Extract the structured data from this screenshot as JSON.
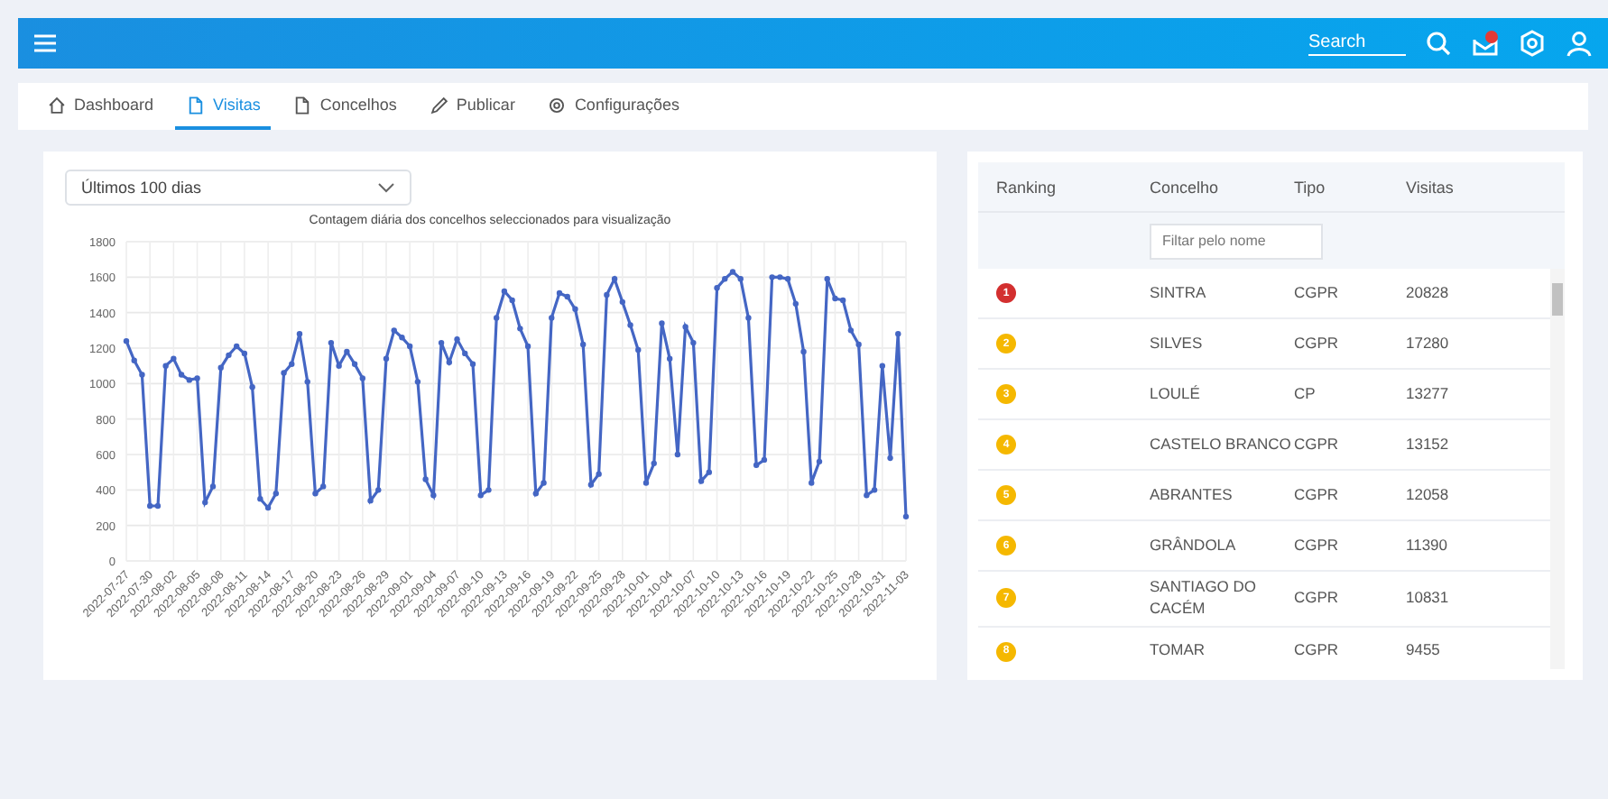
{
  "topbar": {
    "search_placeholder": "Search"
  },
  "tabs": [
    {
      "label": "Dashboard",
      "selected": false
    },
    {
      "label": "Visitas",
      "selected": true
    },
    {
      "label": "Concelhos",
      "selected": false
    },
    {
      "label": "Publicar",
      "selected": false
    },
    {
      "label": "Configurações",
      "selected": false
    }
  ],
  "period_select": {
    "value": "Últimos 100 dias"
  },
  "chart": {
    "chart_data": {
      "type": "line",
      "title": "Contagem diária dos concelhos seleccionados para visualização",
      "categories": [
        "2022-07-27",
        null,
        null,
        "2022-07-30",
        null,
        null,
        "2022-08-02",
        null,
        null,
        "2022-08-05",
        null,
        null,
        "2022-08-08",
        null,
        null,
        "2022-08-11",
        null,
        null,
        "2022-08-14",
        null,
        null,
        "2022-08-17",
        null,
        null,
        "2022-08-20",
        null,
        null,
        "2022-08-23",
        null,
        null,
        "2022-08-26",
        null,
        null,
        "2022-08-29",
        null,
        null,
        "2022-09-01",
        null,
        null,
        "2022-09-04",
        null,
        null,
        "2022-09-07",
        null,
        null,
        "2022-09-10",
        null,
        null,
        "2022-09-13",
        null,
        null,
        "2022-09-16",
        null,
        null,
        "2022-09-19",
        null,
        null,
        "2022-09-22",
        null,
        null,
        "2022-09-25",
        null,
        null,
        "2022-09-28",
        null,
        null,
        "2022-10-01",
        null,
        null,
        "2022-10-04",
        null,
        null,
        "2022-10-07",
        null,
        null,
        "2022-10-10",
        null,
        null,
        "2022-10-13",
        null,
        null,
        "2022-10-16",
        null,
        null,
        "2022-10-19",
        null,
        null,
        "2022-10-22",
        null,
        null,
        "2022-10-25",
        null,
        null,
        "2022-10-28",
        null,
        null,
        "2022-10-31",
        null,
        null,
        "2022-11-03"
      ],
      "grid": true,
      "series": [
        {
          "color": "#4466c4",
          "marker": true,
          "values": [
            1240,
            1130,
            1050,
            310,
            310,
            1100,
            1140,
            1050,
            1020,
            1030,
            330,
            420,
            1090,
            1160,
            1210,
            1170,
            980,
            350,
            300,
            380,
            1060,
            1110,
            1280,
            1010,
            380,
            420,
            1230,
            1100,
            1180,
            1110,
            1030,
            340,
            400,
            1140,
            1300,
            1260,
            1210,
            1010,
            460,
            370,
            1230,
            1120,
            1250,
            1170,
            1110,
            370,
            400,
            1370,
            1520,
            1470,
            1310,
            1210,
            380,
            440,
            1370,
            1510,
            1490,
            1420,
            1220,
            430,
            490,
            1500,
            1590,
            1460,
            1330,
            1190,
            440,
            550,
            1340,
            1140,
            600,
            1320,
            1230,
            450,
            500,
            1540,
            1590,
            1630,
            1590,
            1370,
            540,
            570,
            1600,
            1600,
            1590,
            1450,
            1180,
            440,
            560,
            1590,
            1480,
            1470,
            1300,
            1220,
            370,
            400,
            1100,
            580,
            1280,
            250
          ]
        }
      ],
      "ylim": [
        0,
        1800
      ],
      "yticks": [
        0,
        200,
        400,
        600,
        800,
        1000,
        1200,
        1400,
        1600,
        1800
      ]
    }
  },
  "ranking_table": {
    "columns": [
      "Ranking",
      "Concelho",
      "Tipo",
      "Visitas"
    ],
    "filter_placeholder": "Filtar pelo nome",
    "rows": [
      {
        "rank": "1",
        "color": "#d32f2f",
        "concelho": "SINTRA",
        "tipo": "CGPR",
        "visitas": "20828"
      },
      {
        "rank": "2",
        "color": "#f5b800",
        "concelho": "SILVES",
        "tipo": "CGPR",
        "visitas": "17280"
      },
      {
        "rank": "3",
        "color": "#f5b800",
        "concelho": "LOULÉ",
        "tipo": "CP",
        "visitas": "13277"
      },
      {
        "rank": "4",
        "color": "#f5b800",
        "concelho": "CASTELO BRANCO",
        "tipo": "CGPR",
        "visitas": "13152"
      },
      {
        "rank": "5",
        "color": "#f5b800",
        "concelho": "ABRANTES",
        "tipo": "CGPR",
        "visitas": "12058"
      },
      {
        "rank": "6",
        "color": "#f5b800",
        "concelho": "GRÂNDOLA",
        "tipo": "CGPR",
        "visitas": "11390"
      },
      {
        "rank": "7",
        "color": "#f5b800",
        "concelho": "SANTIAGO DO CACÉM",
        "tipo": "CGPR",
        "visitas": "10831"
      },
      {
        "rank": "8",
        "color": "#f5b800",
        "concelho": "TOMAR",
        "tipo": "CGPR",
        "visitas": "9455"
      }
    ]
  }
}
